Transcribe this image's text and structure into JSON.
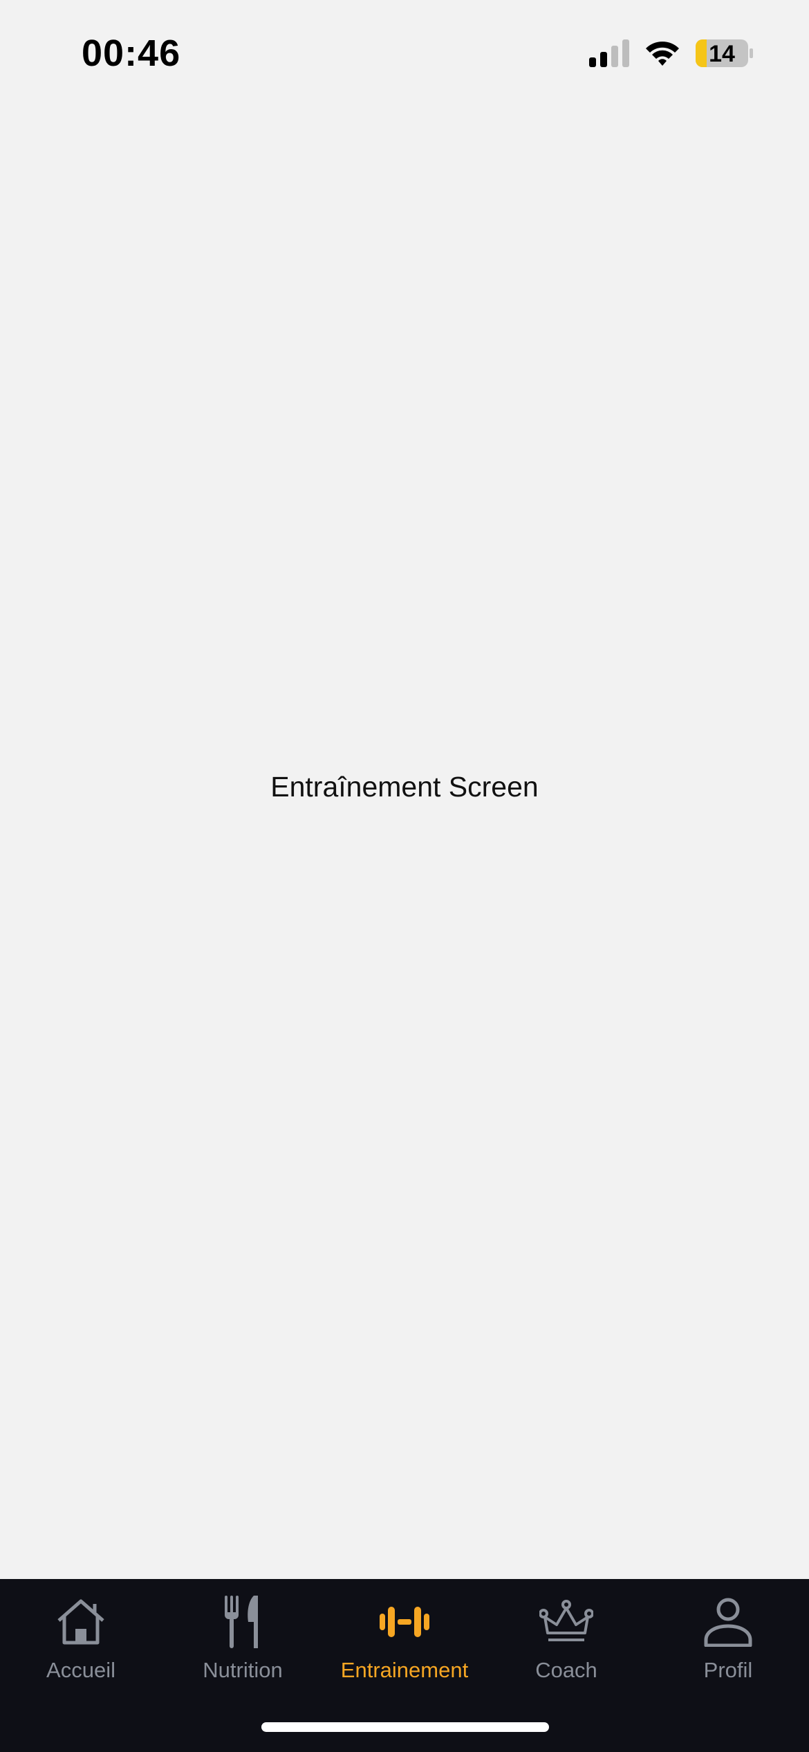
{
  "status_bar": {
    "time": "00:46",
    "battery_level": "14",
    "icons": [
      "signal-icon",
      "wifi-icon",
      "battery-icon"
    ],
    "battery_color": "#f5c518"
  },
  "main": {
    "title": "Entraînement Screen"
  },
  "tab_bar": {
    "background": "#0e0f16",
    "active_color": "#f6a623",
    "inactive_color": "#8a8f99",
    "items": [
      {
        "label": "Accueil",
        "icon": "home-icon",
        "active": false
      },
      {
        "label": "Nutrition",
        "icon": "fork-knife-icon",
        "active": false
      },
      {
        "label": "Entrainement",
        "icon": "dumbbell-icon",
        "active": true
      },
      {
        "label": "Coach",
        "icon": "crown-icon",
        "active": false
      },
      {
        "label": "Profil",
        "icon": "person-icon",
        "active": false
      }
    ]
  }
}
